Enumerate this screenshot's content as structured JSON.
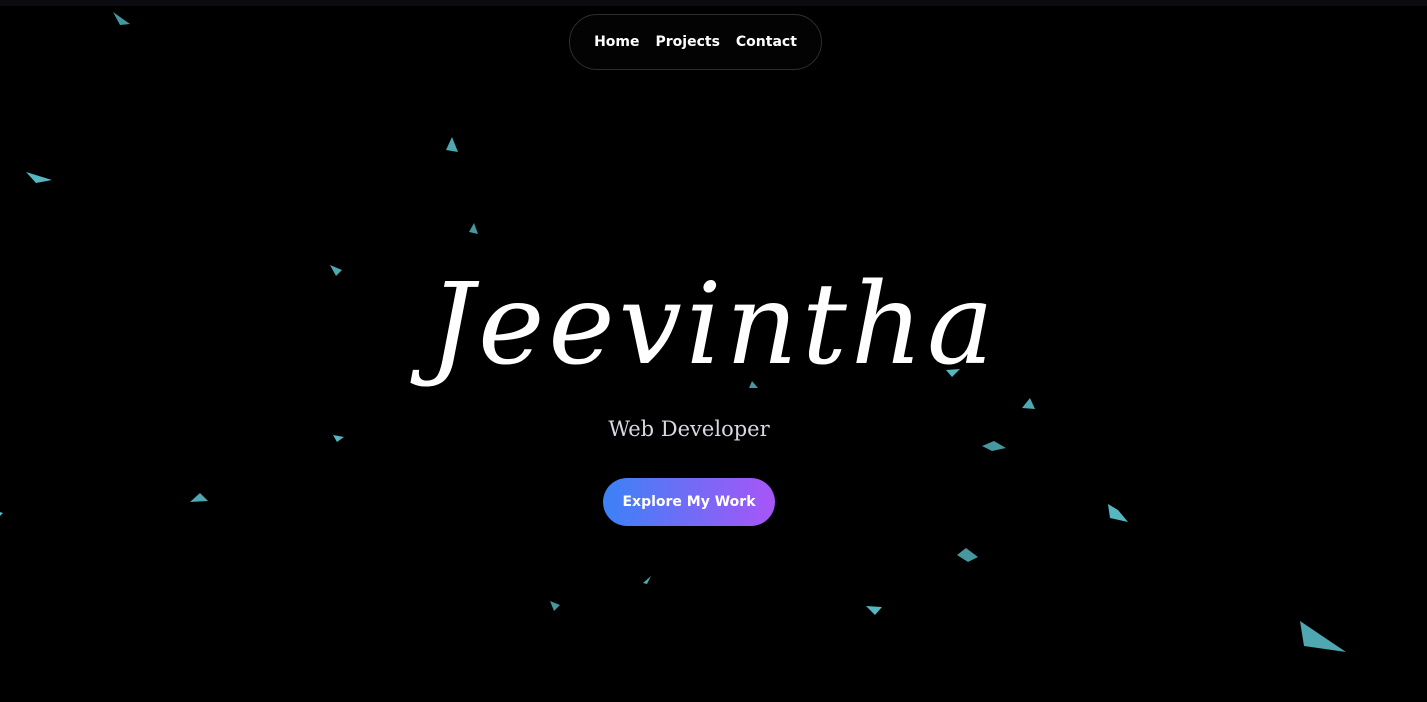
{
  "nav": {
    "items": [
      {
        "label": "Home"
      },
      {
        "label": "Projects"
      },
      {
        "label": "Contact"
      }
    ]
  },
  "hero": {
    "name": "Jeevintha",
    "subtitle": "Web Developer",
    "cta_label": "Explore My Work"
  },
  "colors": {
    "background": "#000000",
    "particle": "#5fc9d6",
    "cta_gradient_start": "#3b82f6",
    "cta_gradient_end": "#a855f7"
  }
}
